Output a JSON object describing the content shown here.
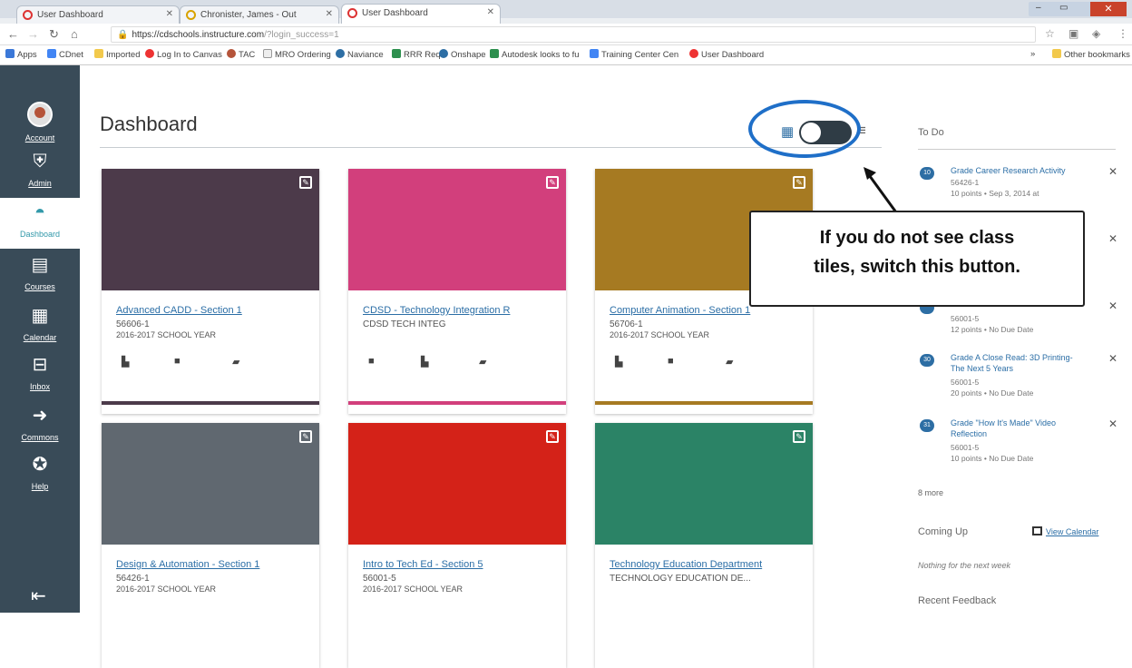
{
  "browser": {
    "tabs": [
      {
        "label": "User Dashboard"
      },
      {
        "label": "Chronister, James - Out"
      },
      {
        "label": "User Dashboard"
      }
    ],
    "url": {
      "host": "https://cdschools.instructure.com",
      "path": "/?login_success=1"
    },
    "bookmarks": [
      "Apps",
      "CDnet",
      "Imported",
      "Log In to Canvas",
      "TAC",
      "MRO Ordering",
      "Naviance",
      "RRR Req",
      "Onshape",
      "Autodesk looks to fu",
      "Training Center Cen",
      "User Dashboard",
      "»",
      "Other bookmarks"
    ]
  },
  "sidebar": {
    "items": [
      {
        "label": "Account"
      },
      {
        "label": "Admin"
      },
      {
        "label": "Dashboard"
      },
      {
        "label": "Courses"
      },
      {
        "label": "Calendar"
      },
      {
        "label": "Inbox"
      },
      {
        "label": "Commons"
      },
      {
        "label": "Help"
      }
    ]
  },
  "main": {
    "title": "Dashboard",
    "callout": {
      "line1": "If you do not see class",
      "line2": "tiles, switch this button."
    }
  },
  "cards": [
    {
      "name": "Advanced CADD - Section 1",
      "code": "56606-1",
      "term": "2016-2017 SCHOOL YEAR",
      "color": "#4c3a4a"
    },
    {
      "name": "CDSD - Technology Integration R",
      "code": "CDSD TECH INTEG",
      "term": "",
      "color": "#d23f7c"
    },
    {
      "name": "Computer Animation - Section 1",
      "code": "56706-1",
      "term": "2016-2017 SCHOOL YEAR",
      "color": "#a67a22"
    },
    {
      "name": "Design & Automation - Section 1",
      "code": "56426-1",
      "term": "2016-2017 SCHOOL YEAR",
      "color": "#606870"
    },
    {
      "name": "Intro to Tech Ed - Section 5",
      "code": "56001-5",
      "term": "2016-2017 SCHOOL YEAR",
      "color": "#d42218"
    },
    {
      "name": "Technology Education Department",
      "code": "TECHNOLOGY EDUCATION DE...",
      "term": "",
      "color": "#2b8366"
    }
  ],
  "todo": {
    "header": "To Do",
    "items": [
      {
        "badge": "10",
        "title": "Grade Career Research Activity",
        "code": "56426-1",
        "meta": "10 points • Sep 3, 2014 at"
      },
      {
        "badge": "",
        "title": "",
        "code": "56001-5",
        "meta": "12 points • No Due Date"
      },
      {
        "badge": "30",
        "title": "Grade A Close Read: 3D Printing- The Next 5 Years",
        "code": "56001-5",
        "meta": "20 points • No Due Date"
      },
      {
        "badge": "31",
        "title": "Grade \"How It's Made\" Video Reflection",
        "code": "56001-5",
        "meta": "10 points • No Due Date"
      }
    ],
    "more": "8 more",
    "coming_up": "Coming Up",
    "view_calendar": "View Calendar",
    "nothing": "Nothing for the next week",
    "recent_feedback": "Recent Feedback"
  }
}
